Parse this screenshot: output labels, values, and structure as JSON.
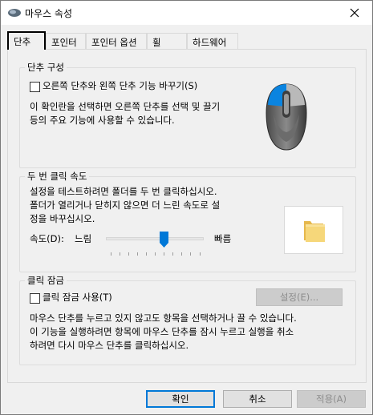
{
  "window": {
    "title": "마우스 속성"
  },
  "tabs": [
    {
      "label": "단추",
      "active": true
    },
    {
      "label": "포인터",
      "active": false
    },
    {
      "label": "포인터 옵션",
      "active": false
    },
    {
      "label": "휠",
      "active": false
    },
    {
      "label": "하드웨어",
      "active": false
    }
  ],
  "button_config": {
    "title": "단추 구성",
    "checkbox_label": "오른쪽 단추와 왼쪽 단추 기능 바꾸기(S)",
    "checked": false,
    "description_line1": "이 확인란을 선택하면 오른쪽 단추를 선택 및 끌기",
    "description_line2": "등의 주요 기능에 사용할 수 있습니다."
  },
  "double_click": {
    "title": "두 번 클릭 속도",
    "description_line1": "설정을 테스트하려면 폴더를 두 번 클릭하십시오.",
    "description_line2": "폴더가 열리거나 닫히지 않으면 더 느린 속도로 설",
    "description_line3": "정을 바꾸십시오.",
    "speed_label": "속도(D):",
    "slow_label": "느림",
    "fast_label": "빠름",
    "speed_value": 0.6
  },
  "click_lock": {
    "title": "클릭 잠금",
    "checkbox_label": "클릭 잠금 사용(T)",
    "checked": false,
    "settings_button": "설정(E)...",
    "description_line1": "마우스 단추를 누르고 있지 않고도 항목을 선택하거나 끌 수 있습니다.",
    "description_line2": "이 기능을 실행하려면 항목에 마우스 단추를 잠시 누르고 실행을 취소",
    "description_line3": "하려면 다시 마우스 단추를 클릭하십시오."
  },
  "footer": {
    "ok": "확인",
    "cancel": "취소",
    "apply": "적용(A)"
  },
  "colors": {
    "accent": "#0078d7",
    "mouse_highlight": "#0a84e0"
  }
}
